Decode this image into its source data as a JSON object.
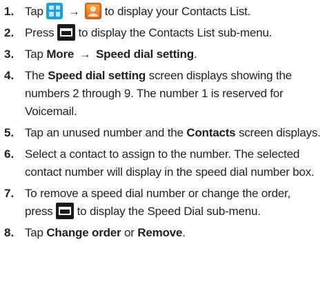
{
  "steps": [
    {
      "num": "1.",
      "pre": "Tap",
      "arrow": "→",
      "post": "to display your Contacts List.",
      "icons": [
        "apps-grid-icon",
        "contacts-icon"
      ]
    },
    {
      "num": "2.",
      "pre": "Press",
      "post": "to display the Contacts List sub-menu.",
      "icons": [
        "menu-key-icon"
      ]
    },
    {
      "num": "3.",
      "pre": "Tap",
      "bold1": "More",
      "arrow": "→",
      "bold2": "Speed dial setting",
      "end": "."
    },
    {
      "num": "4.",
      "pre": "The",
      "bold1": "Speed dial setting",
      "post": "screen displays showing the numbers 2 through 9. The number 1 is reserved for Voicemail."
    },
    {
      "num": "5.",
      "pre": "Tap an unused number and the",
      "bold1": "Contacts",
      "post": "screen displays."
    },
    {
      "num": "6.",
      "text": "Select a contact to assign to the number. The selected contact number will display in the speed dial number box."
    },
    {
      "num": "7.",
      "pre": "To remove a speed dial number or change the order, press",
      "post": "to display the Speed Dial sub-menu.",
      "icons": [
        "menu-key-icon"
      ]
    },
    {
      "num": "8.",
      "pre": "Tap",
      "bold1": "Change order",
      "mid": "or",
      "bold2": "Remove",
      "end": "."
    }
  ]
}
